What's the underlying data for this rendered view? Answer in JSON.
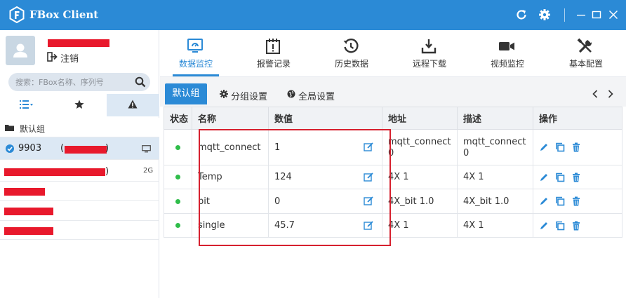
{
  "app": {
    "title": "FBox Client"
  },
  "titlebar": {
    "icons": [
      "refresh-icon",
      "gear-icon",
      "minimize-icon",
      "maximize-icon",
      "close-icon"
    ]
  },
  "profile": {
    "logout_label": "注销"
  },
  "search": {
    "placeholder": "搜索：FBox名称、序列号"
  },
  "left_tabs": [
    "list-icon",
    "star-icon",
    "alert-icon"
  ],
  "groups": [
    {
      "label": "默认组"
    }
  ],
  "devices": [
    {
      "name": "9903",
      "paren_open": "(",
      "paren_close": ")",
      "selected": true
    },
    {
      "name": "",
      "paren_close": ")",
      "badge": "2G"
    },
    {
      "name": ""
    },
    {
      "name": ""
    },
    {
      "name": ""
    }
  ],
  "nav": {
    "items": [
      {
        "label": "数据监控",
        "icon": "monitor-icon",
        "active": true
      },
      {
        "label": "报警记录",
        "icon": "alarm-icon"
      },
      {
        "label": "历史数据",
        "icon": "history-icon"
      },
      {
        "label": "远程下载",
        "icon": "download-icon"
      },
      {
        "label": "视频监控",
        "icon": "video-icon"
      },
      {
        "label": "基本配置",
        "icon": "tools-icon"
      }
    ]
  },
  "subtabs": {
    "default_group": "默认组",
    "group_settings": "分组设置",
    "global_settings": "全局设置"
  },
  "table": {
    "headers": [
      "状态",
      "名称",
      "数值",
      "地址",
      "描述",
      "操作"
    ],
    "rows": [
      {
        "name": "mqtt_connect",
        "value": "1",
        "address_line1": "mqtt_connect",
        "address_line2": "0",
        "desc_line1": "mqtt_connect",
        "desc_line2": "0",
        "status": "online"
      },
      {
        "name": "Temp",
        "value": "124",
        "address": "4X 1",
        "desc": "4X 1",
        "status": "online"
      },
      {
        "name": "bit",
        "value": "0",
        "address": "4X_bit 1.0",
        "desc": "4X_bit 1.0",
        "status": "online"
      },
      {
        "name": "single",
        "value": "45.7",
        "address": "4X 1",
        "desc": "4X 1",
        "status": "online"
      }
    ]
  },
  "colors": {
    "primary": "#2b8ad6",
    "online": "#2fbd4a",
    "redaction": "#e8192c"
  }
}
